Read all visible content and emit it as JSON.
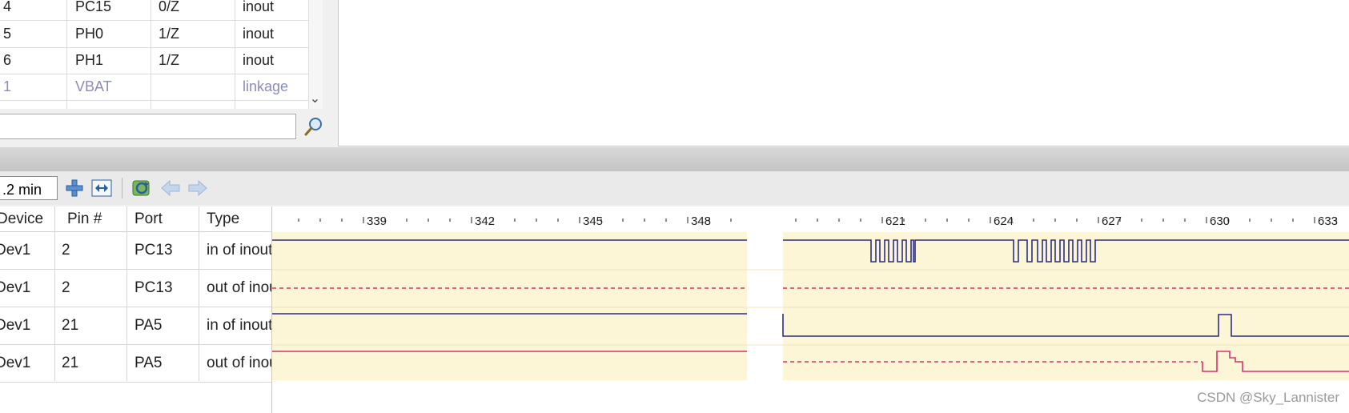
{
  "pin_table": {
    "rows": [
      {
        "num": "4",
        "name": "PC15",
        "state": "0/Z",
        "type": "inout",
        "disabled": false
      },
      {
        "num": "5",
        "name": "PH0",
        "state": "1/Z",
        "type": "inout",
        "disabled": false
      },
      {
        "num": "6",
        "name": "PH1",
        "state": "1/Z",
        "type": "inout",
        "disabled": false
      },
      {
        "num": "1",
        "name": "VBAT",
        "state": "",
        "type": "linkage",
        "disabled": true
      }
    ]
  },
  "search": {
    "value": "",
    "placeholder": ""
  },
  "toolbar": {
    "zoom_value": ".2 min",
    "buttons": [
      "zoom-in-icon",
      "fit-width-icon",
      "refresh-icon",
      "arrow-left-icon",
      "arrow-right-icon"
    ]
  },
  "signal_table": {
    "headers": {
      "device": "Device",
      "pin": "Pin #",
      "port": "Port",
      "type": "Type"
    },
    "rows": [
      {
        "device": "Dev1",
        "pin": "2",
        "port": "PC13",
        "type": "in of inout"
      },
      {
        "device": "Dev1",
        "pin": "2",
        "port": "PC13",
        "type": "out of inout"
      },
      {
        "device": "Dev1",
        "pin": "21",
        "port": "PA5",
        "type": "in of inout"
      },
      {
        "device": "Dev1",
        "pin": "21",
        "port": "PA5",
        "type": "out of inout"
      }
    ]
  },
  "timeline": {
    "segment1_labels": [
      "339",
      "342",
      "345",
      "348"
    ],
    "segment2_labels": [
      "621",
      "624",
      "627",
      "630",
      "633"
    ]
  },
  "colors": {
    "wave_in": "#2b2f86",
    "wave_out": "#d6336c",
    "wave_bg": "#fdf6d6"
  },
  "watermark": "CSDN @Sky_Lannister"
}
